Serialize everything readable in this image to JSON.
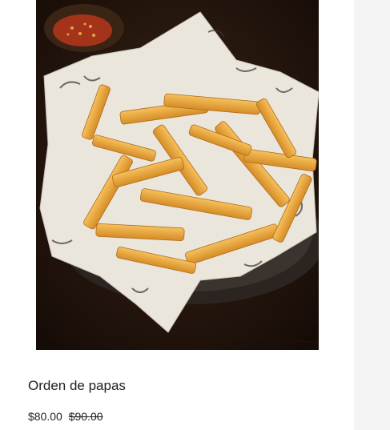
{
  "product": {
    "image_alt": "Canasta de papas fritas sobre papel",
    "title": "Orden de papas",
    "price": "$80.00",
    "old_price": "$90.00"
  },
  "colors": {
    "background": "#ffffff",
    "gutter": "#f4f4f4",
    "text": "#1f1f1f"
  }
}
